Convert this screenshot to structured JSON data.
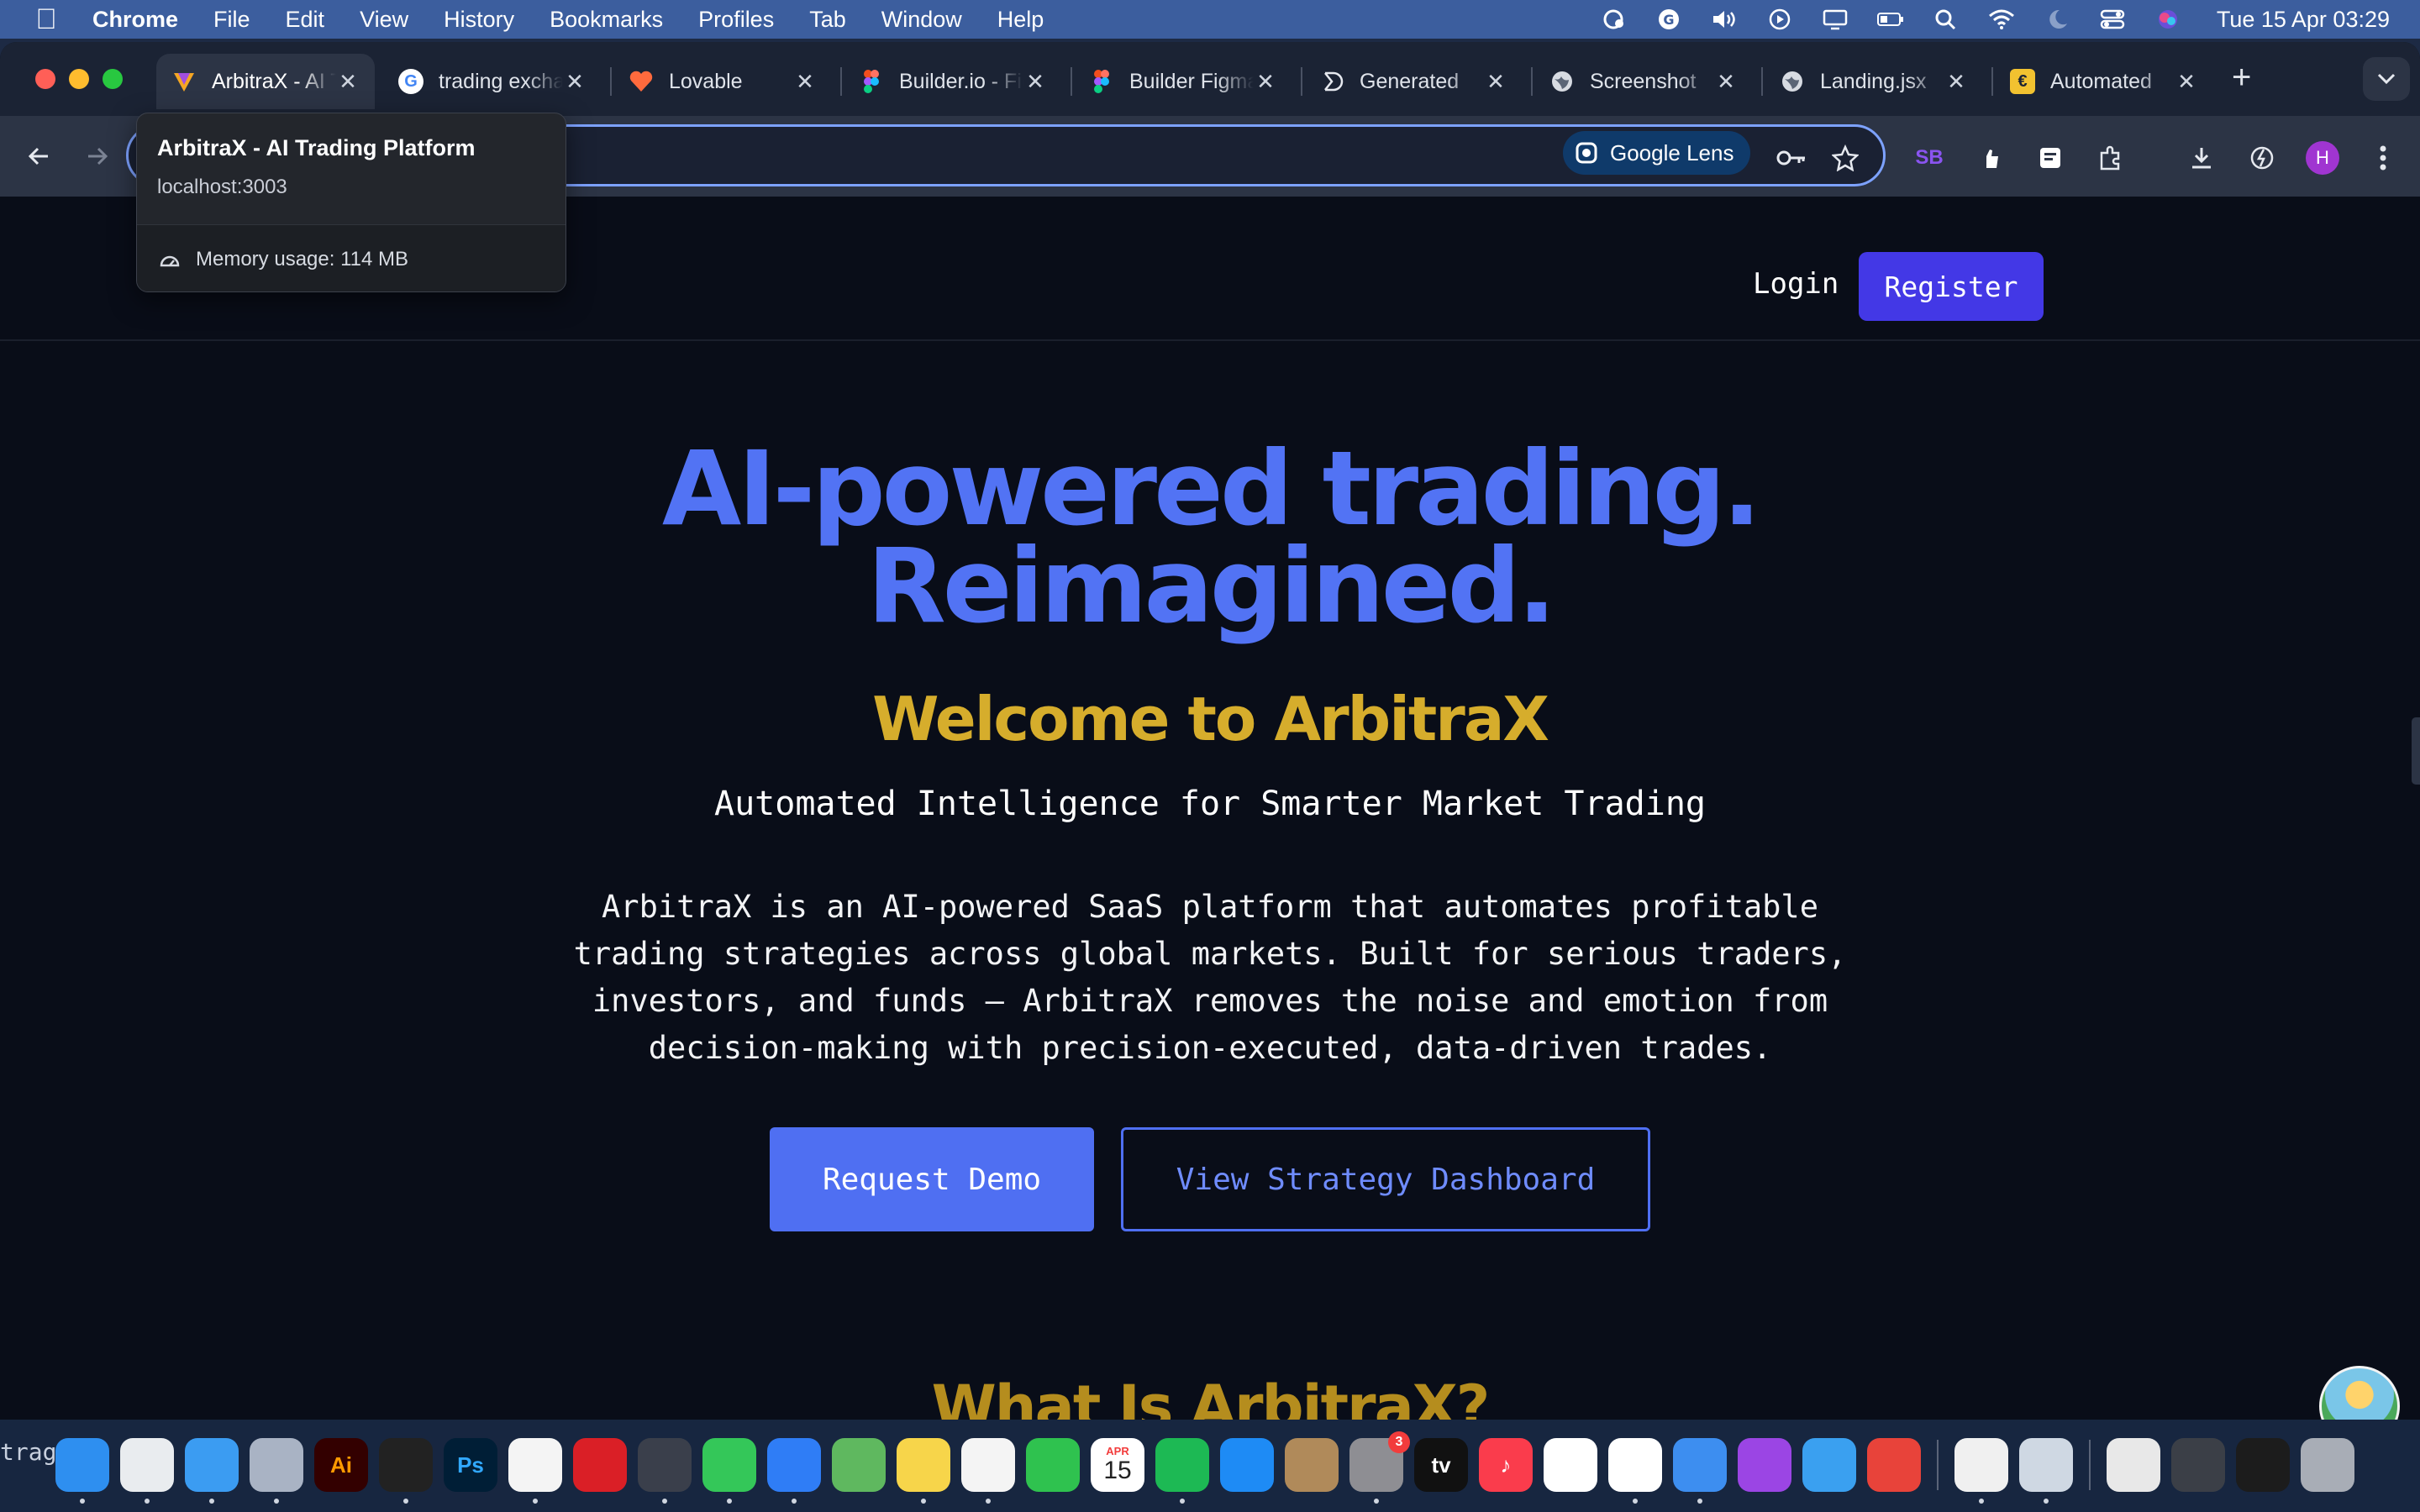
{
  "menubar": {
    "app_name": "Chrome",
    "items": [
      "File",
      "Edit",
      "View",
      "History",
      "Bookmarks",
      "Profiles",
      "Tab",
      "Window",
      "Help"
    ],
    "clock": "Tue 15 Apr  03:29"
  },
  "tabs": [
    {
      "label": "ArbitraX - AI Trading Platform",
      "favicon": "arbitrax-logo",
      "active": true
    },
    {
      "label": "trading exchange",
      "favicon": "google-icon"
    },
    {
      "label": "Lovable",
      "favicon": "lovable-heart-icon"
    },
    {
      "label": "Builder.io - Figma",
      "favicon": "figma-icon"
    },
    {
      "label": "Builder Figma",
      "favicon": "figma-icon"
    },
    {
      "label": "Generated",
      "favicon": "generated-icon"
    },
    {
      "label": "Screenshot",
      "favicon": "globe-icon"
    },
    {
      "label": "Landing.jsx",
      "favicon": "globe-icon"
    },
    {
      "label": "Automated",
      "favicon": "automated-icon"
    }
  ],
  "toolbar": {
    "lens_label": "Google Lens",
    "profile_initial": "H",
    "sb_label": "SB"
  },
  "hover_card": {
    "title": "ArbitraX - AI Trading Platform",
    "url": "localhost:3003",
    "memory": "Memory usage: 114 MB"
  },
  "page": {
    "nav": {
      "login": "Login",
      "register": "Register"
    },
    "hero_title_line1": "AI-powered trading.",
    "hero_title_line2": "Reimagined.",
    "welcome": "Welcome to ArbitraX",
    "tagline": "Automated Intelligence for Smarter Market Trading",
    "description": "ArbitraX is an AI-powered SaaS platform that automates profitable trading strategies across global markets. Built for serious traders, investors, and funds — ArbitraX removes the noise and emotion from decision-making with precision-executed, data-driven trades.",
    "cta_primary": "Request Demo",
    "cta_secondary": "View Strategy Dashboard",
    "next_section_heading": "What Is ArbitraX?"
  },
  "dock": {
    "edge_text": "trag",
    "calendar_month": "APR",
    "calendar_day": "15",
    "settings_badge": "3",
    "apps": [
      {
        "name": "finder",
        "color": "#2e8ff0",
        "glyph": ""
      },
      {
        "name": "chrome",
        "color": "#e9ecef",
        "glyph": ""
      },
      {
        "name": "safari",
        "color": "#3b9cf2",
        "glyph": ""
      },
      {
        "name": "launchpad",
        "color": "#a9b3c4",
        "glyph": ""
      },
      {
        "name": "illustrator",
        "color": "#330000",
        "glyph": "Ai"
      },
      {
        "name": "cursor",
        "color": "#222222",
        "glyph": ""
      },
      {
        "name": "photoshop",
        "color": "#001e36",
        "glyph": "Ps"
      },
      {
        "name": "photos",
        "color": "#f4f4f4",
        "glyph": ""
      },
      {
        "name": "creative-cloud",
        "color": "#da1f26",
        "glyph": ""
      },
      {
        "name": "screenshot-app",
        "color": "#3a3f4b",
        "glyph": ""
      },
      {
        "name": "messages",
        "color": "#34c759",
        "glyph": ""
      },
      {
        "name": "mail",
        "color": "#2f7df6",
        "glyph": ""
      },
      {
        "name": "maps",
        "color": "#5fb85f",
        "glyph": ""
      },
      {
        "name": "notes",
        "color": "#f7d54a",
        "glyph": ""
      },
      {
        "name": "freeform",
        "color": "#f4f4f4",
        "glyph": ""
      },
      {
        "name": "facetime",
        "color": "#2fc24f",
        "glyph": ""
      },
      {
        "name": "calendar",
        "color": "#ffffff",
        "glyph": ""
      },
      {
        "name": "spotify",
        "color": "#1db954",
        "glyph": ""
      },
      {
        "name": "app-store",
        "color": "#1e8bf5",
        "glyph": ""
      },
      {
        "name": "contacts",
        "color": "#b08a5a",
        "glyph": ""
      },
      {
        "name": "system-settings",
        "color": "#8e8e93",
        "glyph": ""
      },
      {
        "name": "apple-tv",
        "color": "#111111",
        "glyph": "tv"
      },
      {
        "name": "music",
        "color": "#fa3c4c",
        "glyph": "♪"
      },
      {
        "name": "news",
        "color": "#ffffff",
        "glyph": ""
      },
      {
        "name": "capcut",
        "color": "#ffffff",
        "glyph": ""
      },
      {
        "name": "passwords",
        "color": "#3d8ef0",
        "glyph": ""
      },
      {
        "name": "podcasts",
        "color": "#9b45e4",
        "glyph": ""
      },
      {
        "name": "weather",
        "color": "#3aa0f0",
        "glyph": ""
      },
      {
        "name": "speakerdeck",
        "color": "#e8433a",
        "glyph": ""
      },
      {
        "name": "textedit",
        "color": "#f0f0f0",
        "glyph": ""
      },
      {
        "name": "preview",
        "color": "#cfd8e3",
        "glyph": ""
      },
      {
        "name": "document-stack",
        "color": "#e8e8e8",
        "glyph": ""
      },
      {
        "name": "keyboard-viewer",
        "color": "#3b3f47",
        "glyph": ""
      },
      {
        "name": "terminal-window",
        "color": "#1c1c1c",
        "glyph": ""
      },
      {
        "name": "trash",
        "color": "#a8adb6",
        "glyph": ""
      }
    ]
  },
  "colors": {
    "menubar": "#3c5e9e",
    "page_bg": "#090d18",
    "hero_blue": "#5273f4",
    "welcome_gold": "#d6ad2c",
    "register_bg": "#4338e6",
    "cta_blue": "#4f6ff2"
  }
}
